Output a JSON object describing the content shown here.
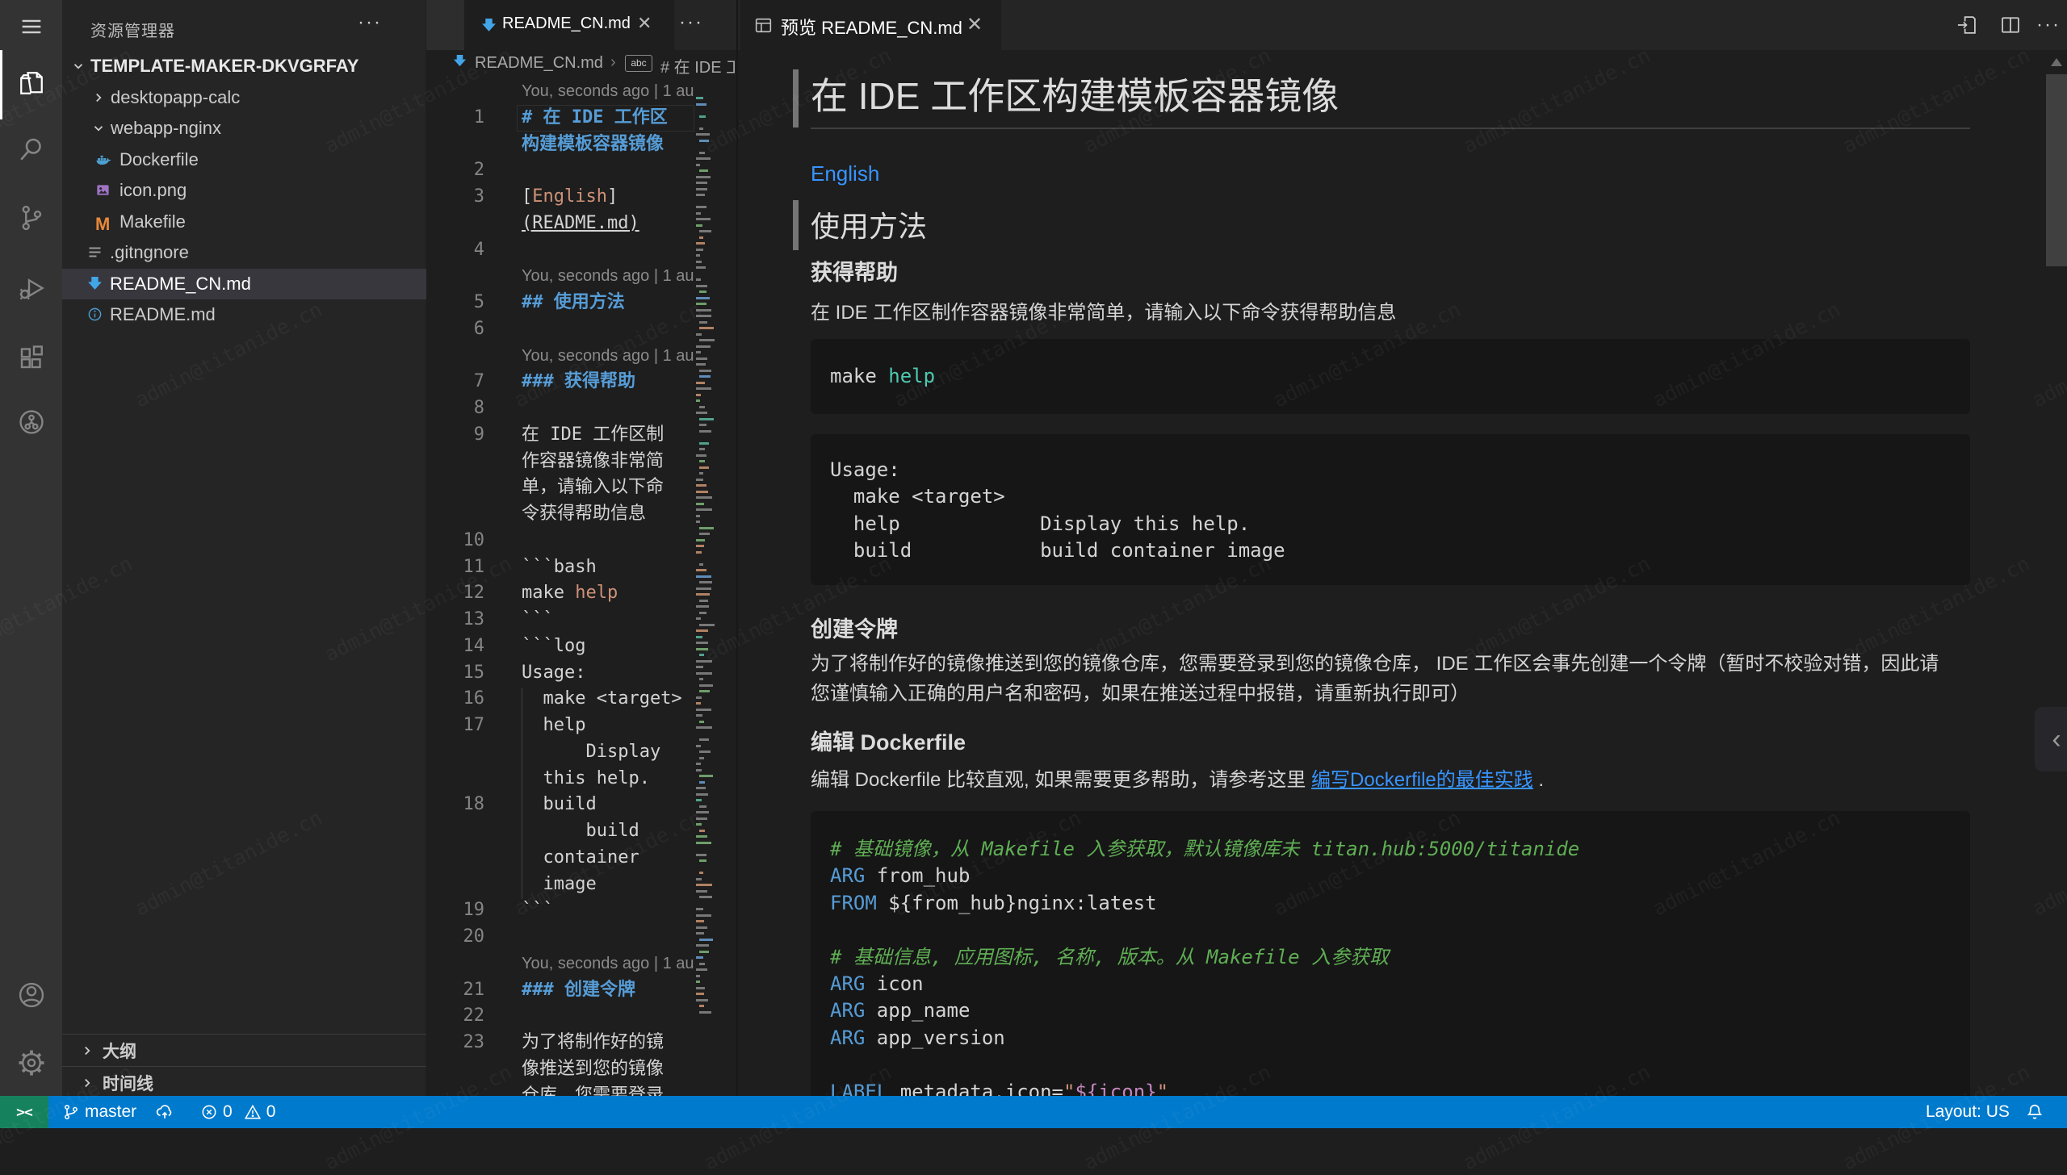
{
  "watermark": "admin@titanide.cn",
  "colors": {
    "statusbar": "#007acc",
    "remote": "#16825d",
    "accent_blue": "#569cd6",
    "link": "#3794ff",
    "string_orange": "#ce9178",
    "comment_green": "#5fae54",
    "teal": "#4ec9b0",
    "interp_pink": "#c586c0"
  },
  "activity_bar": {
    "items": [
      "menu",
      "explorer",
      "search",
      "source-control",
      "run-debug",
      "extensions",
      "remote-explorer"
    ],
    "bottom_items": [
      "accounts",
      "settings"
    ]
  },
  "sidebar": {
    "title": "资源管理器",
    "root": "TEMPLATE-MAKER-DKVGRFAY",
    "items": [
      {
        "label": "desktopapp-calc",
        "type": "folder",
        "expanded": false
      },
      {
        "label": "webapp-nginx",
        "type": "folder",
        "expanded": true
      },
      {
        "label": "Dockerfile",
        "type": "file",
        "icon": "docker",
        "nested": true
      },
      {
        "label": "icon.png",
        "type": "file",
        "icon": "image",
        "nested": true
      },
      {
        "label": "Makefile",
        "type": "file",
        "icon": "makefile",
        "nested": true
      },
      {
        "label": ".gitngnore",
        "type": "file",
        "icon": "list",
        "nested": false
      },
      {
        "label": "README_CN.md",
        "type": "file",
        "icon": "markdown",
        "nested": false,
        "selected": true
      },
      {
        "label": "README.md",
        "type": "file",
        "icon": "info",
        "nested": false
      }
    ],
    "sections": [
      "大纲",
      "时间线"
    ]
  },
  "editor": {
    "tab_label": "README_CN.md",
    "breadcrumb_file": "README_CN.md",
    "breadcrumb_symbol": "# 在 IDE 工作区构建模板容器镜像",
    "codelens": "You, seconds ago | 1 au",
    "lines": [
      {
        "lens": true
      },
      {
        "n": "1",
        "s": [
          [
            "# 在 IDE 工作区",
            "sh"
          ]
        ],
        "box": true
      },
      {
        "s": [
          [
            "构建模板容器镜像",
            "sh"
          ]
        ]
      },
      {
        "n": "2"
      },
      {
        "n": "3",
        "s": [
          [
            "[",
            "st"
          ],
          [
            "English",
            "ss"
          ],
          [
            "]",
            "st"
          ]
        ]
      },
      {
        "s": [
          [
            "(README.md)",
            "st su"
          ]
        ]
      },
      {
        "n": "4"
      },
      {
        "lens": true
      },
      {
        "n": "5",
        "s": [
          [
            "## 使用方法",
            "sh"
          ]
        ]
      },
      {
        "n": "6"
      },
      {
        "lens": true
      },
      {
        "n": "7",
        "s": [
          [
            "### 获得帮助",
            "sh"
          ]
        ]
      },
      {
        "n": "8"
      },
      {
        "n": "9",
        "s": [
          [
            "在 IDE 工作区制",
            "st"
          ]
        ]
      },
      {
        "s": [
          [
            "作容器镜像非常简",
            "st"
          ]
        ]
      },
      {
        "s": [
          [
            "单，请输入以下命",
            "st"
          ]
        ]
      },
      {
        "s": [
          [
            "令获得帮助信息",
            "st"
          ]
        ]
      },
      {
        "n": "10"
      },
      {
        "n": "11",
        "s": [
          [
            "```bash",
            "st"
          ]
        ]
      },
      {
        "n": "12",
        "s": [
          [
            "make ",
            "st"
          ],
          [
            "help",
            "ss"
          ]
        ]
      },
      {
        "n": "13",
        "s": [
          [
            "```",
            "st"
          ]
        ]
      },
      {
        "n": "14",
        "s": [
          [
            "```log",
            "st"
          ]
        ]
      },
      {
        "n": "15",
        "s": [
          [
            "Usage:",
            "st"
          ]
        ]
      },
      {
        "n": "16",
        "s": [
          [
            "  make <target>",
            "st"
          ]
        ],
        "guide": true
      },
      {
        "n": "17",
        "s": [
          [
            "  help",
            "st"
          ]
        ],
        "guide": true
      },
      {
        "s": [
          [
            "      Display",
            "st"
          ]
        ],
        "guide": true
      },
      {
        "s": [
          [
            "  this help.",
            "st"
          ]
        ],
        "guide": true
      },
      {
        "n": "18",
        "s": [
          [
            "  build",
            "st"
          ]
        ],
        "guide": true
      },
      {
        "s": [
          [
            "      build",
            "st"
          ]
        ],
        "guide": true
      },
      {
        "s": [
          [
            "  container",
            "st"
          ]
        ],
        "guide": true
      },
      {
        "s": [
          [
            "  image",
            "st"
          ]
        ],
        "guide": true
      },
      {
        "n": "19",
        "s": [
          [
            "```",
            "st"
          ]
        ]
      },
      {
        "n": "20"
      },
      {
        "lens": true
      },
      {
        "n": "21",
        "s": [
          [
            "### 创建令牌",
            "sh"
          ]
        ]
      },
      {
        "n": "22"
      },
      {
        "n": "23",
        "s": [
          [
            "为了将制作好的镜",
            "st"
          ]
        ]
      },
      {
        "s": [
          [
            "像推送到您的镜像",
            "st"
          ]
        ]
      },
      {
        "s": [
          [
            "仓库，您需要登录",
            "st"
          ]
        ]
      }
    ]
  },
  "preview": {
    "tab_label": "预览 README_CN.md",
    "h1": "在 IDE 工作区构建模板容器镜像",
    "link1": "English",
    "h2": "使用方法",
    "h3a": "获得帮助",
    "p1": "在 IDE 工作区制作容器镜像非常简单，请输入以下命令获得帮助信息",
    "code1": [
      [
        "make ",
        "st"
      ],
      [
        "help",
        "stl"
      ]
    ],
    "code2": "Usage:\n  make <target>\n  help            Display this help.\n  build           build container image",
    "h3b": "创建令牌",
    "p2": "为了将制作好的镜像推送到您的镜像仓库，您需要登录到您的镜像仓库， IDE 工作区会事先创建一个令牌（暂时不校验对错，因此请您谨慎输入正确的用户名和密码，如果在推送过程中报错，请重新执行即可）",
    "h3c": "编辑 Dockerfile",
    "p3_before": "编辑 Dockerfile 比较直观, 如果需要更多帮助，请参考这里 ",
    "p3_link": "编写Dockerfile的最佳实践",
    "p3_after": " .",
    "code3": [
      [
        [
          "# 基础镜像，从 Makefile 入参获取，默认镜像库未 titan.hub:5000/titanide",
          "scm"
        ]
      ],
      [
        [
          "ARG",
          "skw"
        ],
        [
          " from_hub",
          "st"
        ]
      ],
      [
        [
          "FROM",
          "skw"
        ],
        [
          " ${from_hub}nginx:latest",
          "st"
        ]
      ],
      [],
      [
        [
          "# 基础信息, 应用图标, 名称, 版本。从 Makefile 入参获取",
          "scm"
        ]
      ],
      [
        [
          "ARG",
          "skw"
        ],
        [
          " icon",
          "st"
        ]
      ],
      [
        [
          "ARG",
          "skw"
        ],
        [
          " app_name",
          "st"
        ]
      ],
      [
        [
          "ARG",
          "skw"
        ],
        [
          " app_version",
          "st"
        ]
      ],
      [],
      [
        [
          "LABEL",
          "skw"
        ],
        [
          " metadata.icon=",
          "st"
        ],
        [
          "\"",
          "ss"
        ],
        [
          "${icon}",
          "sitp"
        ],
        [
          "\"",
          "ss"
        ]
      ]
    ]
  },
  "status_bar": {
    "branch": "master",
    "errors": "0",
    "warnings": "0",
    "layout": "Layout: US"
  }
}
